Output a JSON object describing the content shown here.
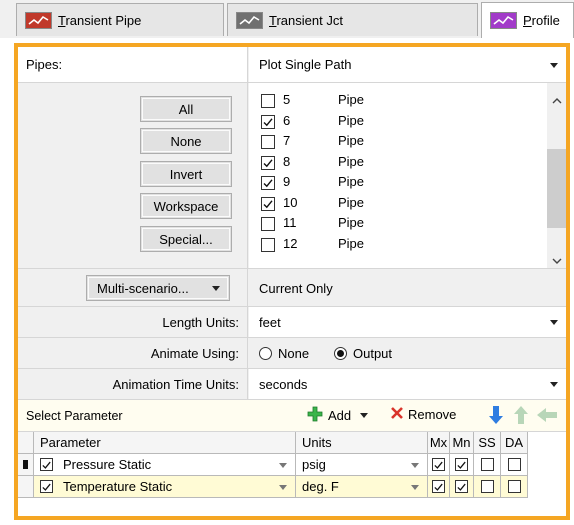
{
  "tabs": [
    {
      "label_underlined": "T",
      "label_rest": "ransient Pipe",
      "icon": "chart-line-icon",
      "color": "#c0392b"
    },
    {
      "label_underlined": "T",
      "label_rest": "ransient Jct",
      "icon": "chart-line-icon",
      "color": "#707070"
    },
    {
      "label_underlined": "P",
      "label_rest": "rofile",
      "icon": "chart-line-icon",
      "color": "#a23bc9"
    }
  ],
  "pipes": {
    "label": "Pipes:",
    "value": "Plot Single Path",
    "buttons": [
      "All",
      "None",
      "Invert",
      "Workspace",
      "Special..."
    ],
    "list": [
      {
        "num": "5",
        "name": "Pipe",
        "checked": false
      },
      {
        "num": "6",
        "name": "Pipe",
        "checked": true
      },
      {
        "num": "7",
        "name": "Pipe",
        "checked": false
      },
      {
        "num": "8",
        "name": "Pipe",
        "checked": true
      },
      {
        "num": "9",
        "name": "Pipe",
        "checked": true
      },
      {
        "num": "10",
        "name": "Pipe",
        "checked": true
      },
      {
        "num": "11",
        "name": "Pipe",
        "checked": false
      },
      {
        "num": "12",
        "name": "Pipe",
        "checked": false
      }
    ]
  },
  "multi_scenario": {
    "button": "Multi-scenario...",
    "value": "Current Only"
  },
  "length_units": {
    "label": "Length Units:",
    "value": "feet"
  },
  "animate": {
    "label": "Animate Using:",
    "options": [
      "None",
      "Output"
    ],
    "selected": "Output"
  },
  "animation_time": {
    "label": "Animation Time Units:",
    "value": "seconds"
  },
  "select_parameter": {
    "label": "Select Parameter",
    "add": "Add",
    "remove": "Remove"
  },
  "param_table": {
    "headers": [
      "Parameter",
      "Units",
      "Mx",
      "Mn",
      "SS",
      "DA"
    ],
    "rows": [
      {
        "checked": true,
        "name": "Pressure Static",
        "units": "psig",
        "mx": true,
        "mn": true,
        "ss": false,
        "da": false,
        "current": true
      },
      {
        "checked": true,
        "name": "Temperature Static",
        "units": "deg. F",
        "mx": true,
        "mn": true,
        "ss": false,
        "da": false,
        "current": false
      }
    ]
  },
  "colors": {
    "accent_border": "#f5a623",
    "row_highlight": "#fffbd5",
    "add_icon": "#3bb54a",
    "remove_icon": "#d9342b",
    "arrow_blue": "#2f7de1"
  }
}
